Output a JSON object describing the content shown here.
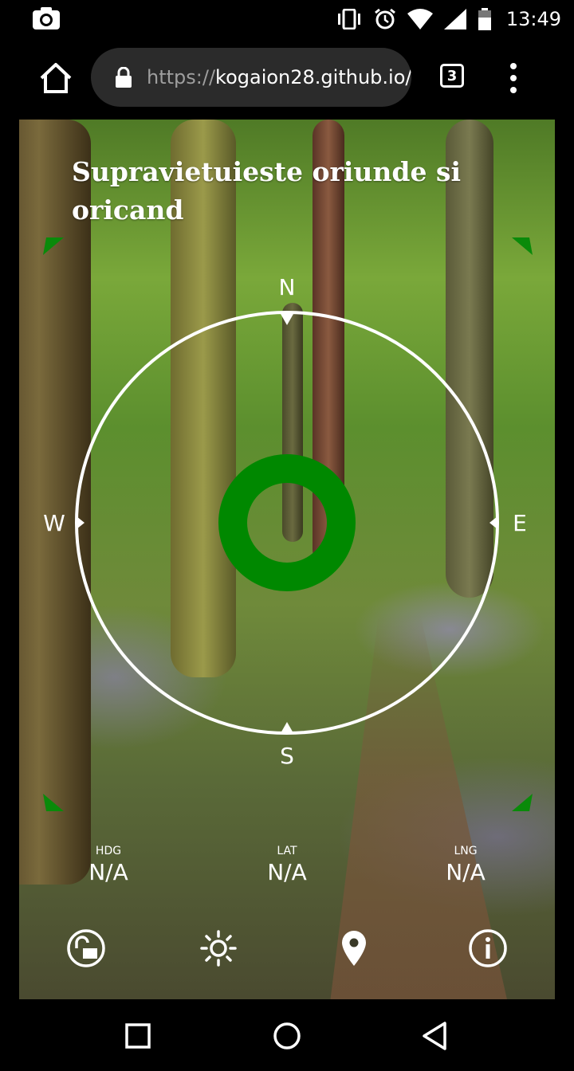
{
  "status_bar": {
    "time": "13:49",
    "icons": [
      "camera-icon",
      "vibrate-icon",
      "alarm-icon",
      "wifi-icon",
      "signal-icon",
      "battery-icon"
    ]
  },
  "browser": {
    "url_scheme": "https://",
    "url_host": "kogaion28.github.io/",
    "tab_count": "3",
    "icons": [
      "home-icon",
      "lock-icon",
      "more-vert-icon"
    ]
  },
  "app": {
    "title": "Supravietuieste oriunde si oricand",
    "compass": {
      "north": "N",
      "south": "S",
      "east": "E",
      "west": "W",
      "ring_color": "#ffffff",
      "center_color": "#008800"
    },
    "readouts": [
      {
        "label": "HDG",
        "value": "N/A"
      },
      {
        "label": "LAT",
        "value": "N/A"
      },
      {
        "label": "LNG",
        "value": "N/A"
      }
    ],
    "actions": [
      "lock-open-icon",
      "brightness-icon",
      "location-pin-icon",
      "info-icon"
    ],
    "accent_color": "#0a8a0a"
  },
  "navigation": {
    "buttons": [
      "recents-icon",
      "home-circle-icon",
      "back-icon"
    ]
  }
}
